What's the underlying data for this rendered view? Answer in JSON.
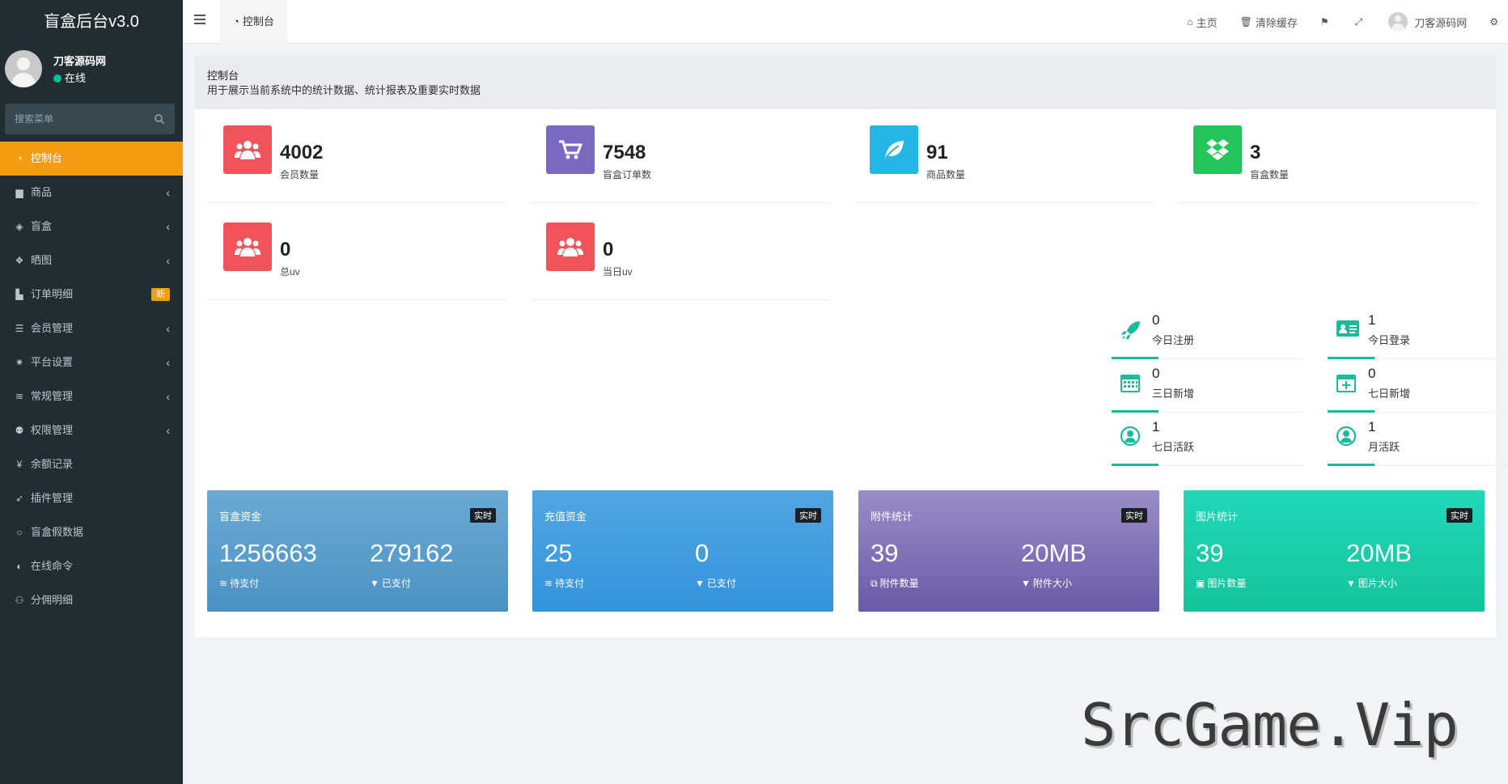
{
  "sidebar": {
    "brand": "盲盒后台v3.0",
    "user_name": "刀客源码网",
    "user_status": "在线",
    "search_placeholder": "搜索菜单",
    "items": [
      {
        "label": "控制台",
        "icon": "dashboard-icon",
        "glyph": "◔",
        "active": true
      },
      {
        "label": "商品",
        "icon": "shopping-bag-icon",
        "glyph": "▆",
        "arrow": "‹"
      },
      {
        "label": "盲盒",
        "icon": "cube-icon",
        "glyph": "◈",
        "arrow": "‹"
      },
      {
        "label": "晒图",
        "icon": "dropbox-icon",
        "glyph": "❖",
        "arrow": "‹"
      },
      {
        "label": "订单明细",
        "icon": "cart-icon",
        "glyph": "▙",
        "badge": "新"
      },
      {
        "label": "会员管理",
        "icon": "list-icon",
        "glyph": "☰",
        "arrow": "‹"
      },
      {
        "label": "平台设置",
        "icon": "gear-icon",
        "glyph": "✷",
        "arrow": "‹"
      },
      {
        "label": "常规管理",
        "icon": "database-icon",
        "glyph": "≋",
        "arrow": "‹"
      },
      {
        "label": "权限管理",
        "icon": "group-icon",
        "glyph": "⚉",
        "arrow": "‹"
      },
      {
        "label": "余额记录",
        "icon": "yen-icon",
        "glyph": "¥"
      },
      {
        "label": "插件管理",
        "icon": "rocket-icon",
        "glyph": "➶"
      },
      {
        "label": "盲盒假数据",
        "icon": "circle-icon",
        "glyph": "○"
      },
      {
        "label": "在线命令",
        "icon": "adjust-icon",
        "glyph": "◐"
      },
      {
        "label": "分佣明细",
        "icon": "users-icon",
        "glyph": "⚇"
      }
    ]
  },
  "header": {
    "tab_label": "控制台",
    "home": "主页",
    "clear_cache": "清除缓存",
    "username": "刀客源码网"
  },
  "content_header": {
    "title": "控制台",
    "description": "用于展示当前系统中的统计数据、统计报表及重要实时数据"
  },
  "stats": [
    {
      "value": "4002",
      "label": "会员数量",
      "color": "#f0545a",
      "icon": "users-icon"
    },
    {
      "value": "7548",
      "label": "盲盒订单数",
      "color": "#7b68c1",
      "icon": "cart-icon"
    },
    {
      "value": "91",
      "label": "商品数量",
      "color": "#24b6e6",
      "icon": "leaf-icon"
    },
    {
      "value": "3",
      "label": "盲盒数量",
      "color": "#22c65a",
      "icon": "dropbox-icon"
    },
    {
      "value": "0",
      "label": "总uv",
      "color": "#f0545a",
      "icon": "users-icon"
    },
    {
      "value": "0",
      "label": "当日uv",
      "color": "#f0545a",
      "icon": "users-icon"
    }
  ],
  "mini_stats": [
    {
      "value": "0",
      "label": "今日注册",
      "icon": "rocket-icon"
    },
    {
      "value": "1",
      "label": "今日登录",
      "icon": "vcard-icon"
    },
    {
      "value": "0",
      "label": "三日新增",
      "icon": "calendar-icon"
    },
    {
      "value": "0",
      "label": "七日新增",
      "icon": "calendar-plus-icon"
    },
    {
      "value": "1",
      "label": "七日活跃",
      "icon": "user-circle-icon"
    },
    {
      "value": "1",
      "label": "月活跃",
      "icon": "user-circle-icon"
    }
  ],
  "cards": [
    {
      "title": "盲盒资金",
      "badge": "实时",
      "v1": "1256663",
      "l1": "待支付",
      "v2": "279162",
      "l2": "已支付",
      "g1": "#6aaad4",
      "g2": "#4a92c4"
    },
    {
      "title": "充值资金",
      "badge": "实时",
      "v1": "25",
      "l1": "待支付",
      "v2": "0",
      "l2": "已支付",
      "g1": "#52a6e0",
      "g2": "#3394dc"
    },
    {
      "title": "附件统计",
      "badge": "实时",
      "v1": "39",
      "l1": "附件数量",
      "v2": "20MB",
      "l2": "附件大小",
      "g1": "#9b8cc6",
      "g2": "#6a5aa8"
    },
    {
      "title": "图片统计",
      "badge": "实时",
      "v1": "39",
      "l1": "图片数量",
      "v2": "20MB",
      "l2": "图片大小",
      "g1": "#1fd8b8",
      "g2": "#14c49a"
    }
  ],
  "watermark": "SrcGame.Vip"
}
